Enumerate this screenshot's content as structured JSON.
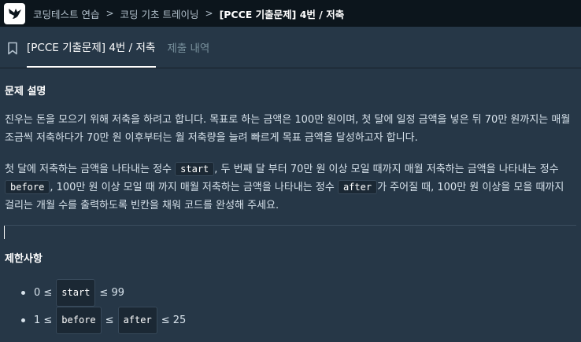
{
  "breadcrumb": {
    "items": [
      "코딩테스트 연습",
      "코딩 기초 트레이닝",
      "[PCCE 기출문제] 4번 / 저축"
    ]
  },
  "tabs": {
    "problem": "[PCCE 기출문제] 4번 / 저축",
    "submissions": "제출 내역"
  },
  "description": {
    "heading": "문제 설명",
    "p1": "진우는 돈을 모으기 위해 저축을 하려고 합니다. 목표로 하는 금액은 100만 원이며, 첫 달에 일정 금액을 넣은 뒤 70만 원까지는 매월 조금씩 저축하다가 70만 원 이후부터는 월 저축량을 늘려 빠르게 목표 금액을 달성하고자 합니다.",
    "p2": {
      "t1": "첫 달에 저축하는 금액을 나타내는 정수 ",
      "c1": "start",
      "t2": ", 두 번째 달 부터 70만 원 이상 모일 때까지 매월 저축하는 금액을 나타내는 정수 ",
      "c2": "before",
      "t3": ", 100만 원 이상 모일 때 까지 매월 저축하는 금액을 나타내는 정수 ",
      "c3": "after",
      "t4": "가 주어질 때, 100만 원 이상을 모을 때까지 걸리는 개월 수를 출력하도록 빈칸을 채워 코드를 완성해 주세요."
    }
  },
  "constraints": {
    "heading": "제한사항",
    "item1": {
      "pre": "0 ≤",
      "code": "start",
      "post": "≤ 99"
    },
    "item2": {
      "pre": "1 ≤",
      "code1": "before",
      "mid": "≤",
      "code2": "after",
      "post": "≤ 25"
    }
  },
  "colors": {
    "background": "#263747",
    "topbar": "#0c151c",
    "text": "#d7e2eb",
    "code_bg": "#1b2834",
    "tab_inactive": "#78909c"
  }
}
